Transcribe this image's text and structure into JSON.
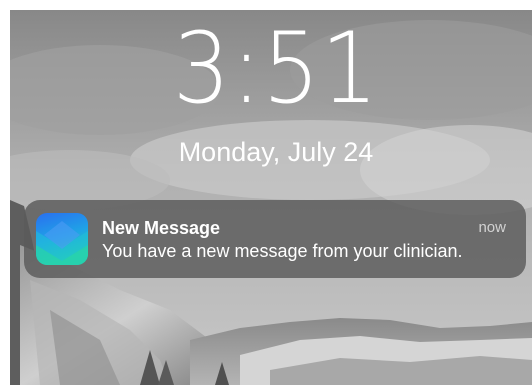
{
  "lock_screen": {
    "time": "3:51",
    "date": "Monday, July 24"
  },
  "notification": {
    "app_icon": "messaging-app-icon",
    "title": "New Message",
    "timestamp": "now",
    "body": "You have a new message from your clinician."
  },
  "colors": {
    "text": "#ffffff",
    "notification_background": "#5a5a5a",
    "icon_gradient_start": "#2a7cf0",
    "icon_gradient_end": "#22d3a8"
  }
}
